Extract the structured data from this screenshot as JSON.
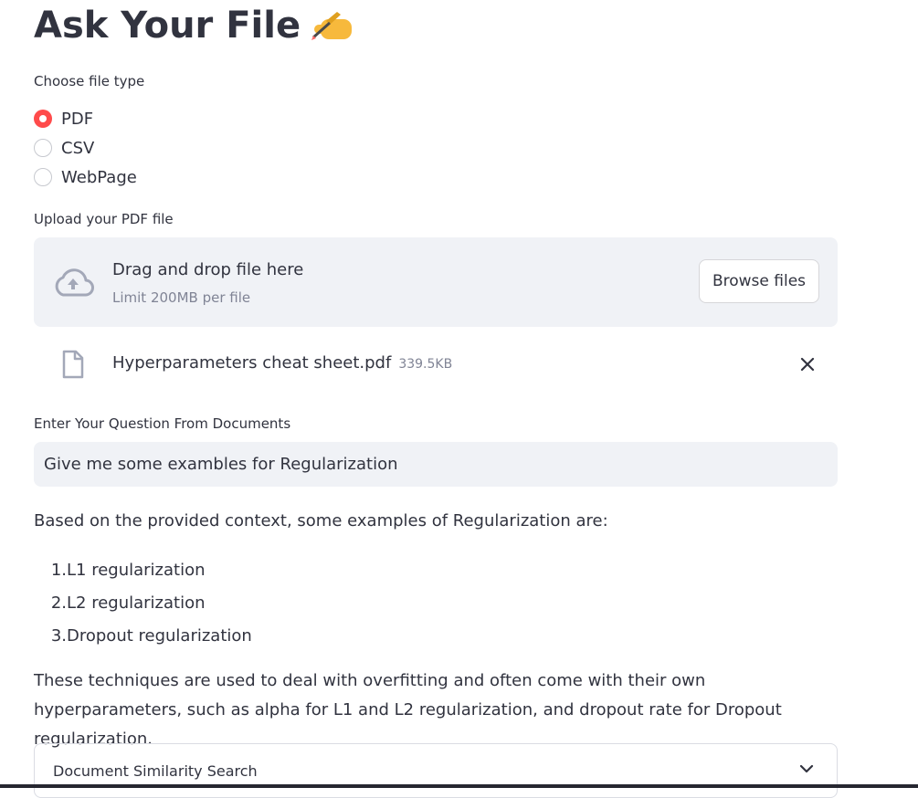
{
  "page": {
    "title": "Ask Your File",
    "title_emoji_icon": "writing-hand-emoji"
  },
  "file_type": {
    "label": "Choose file type",
    "options": [
      "PDF",
      "CSV",
      "WebPage"
    ],
    "selected": "PDF"
  },
  "uploader": {
    "label": "Upload your PDF file",
    "drop_text": "Drag and drop file here",
    "limit_text": "Limit 200MB per file",
    "browse_label": "Browse files",
    "upload_icon": "cloud-upload-icon"
  },
  "uploaded_file": {
    "name": "Hyperparameters cheat sheet.pdf",
    "size": "339.5KB",
    "file_icon": "file-icon",
    "remove_icon": "close-icon"
  },
  "question": {
    "label": "Enter Your Question From Documents",
    "value": "Give me some exambles for Regularization"
  },
  "answer": {
    "intro": "Based on the provided context, some examples of Regularization are:",
    "items": [
      {
        "num": "1.",
        "text": "L1 regularization"
      },
      {
        "num": "2.",
        "text": "L2 regularization"
      },
      {
        "num": "3.",
        "text": "Dropout regularization"
      }
    ],
    "conclusion": "These techniques are used to deal with overfitting and often come with their own hyperparameters, such as alpha for L1 and L2 regularization, and dropout rate for Dropout regularization."
  },
  "expander": {
    "label": "Document Similarity Search",
    "icon": "chevron-down-icon"
  },
  "colors": {
    "accent": "#ff4b4b",
    "text": "#31333f",
    "muted": "#808495",
    "input_bg": "#f0f2f6"
  }
}
